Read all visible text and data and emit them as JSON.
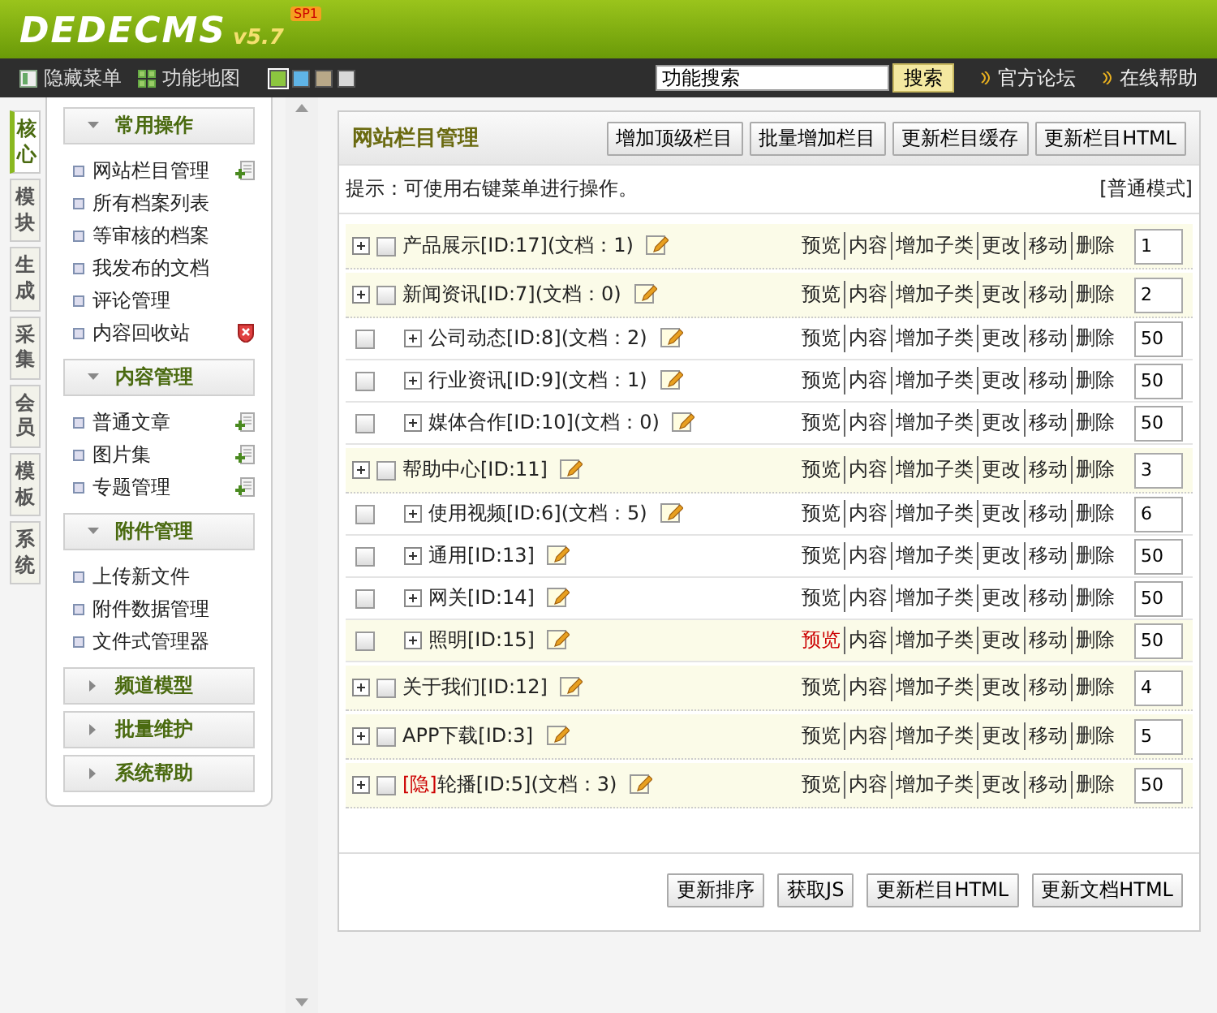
{
  "header": {
    "logo": "DEDECMS",
    "version": "v5.7",
    "edition": "SP1"
  },
  "toolbar": {
    "items": [
      {
        "label": "隐藏菜单",
        "kind": "hide"
      },
      {
        "label": "功能地图",
        "kind": "map"
      }
    ],
    "swatches": [
      {
        "color": "#8cc63f",
        "selected": true
      },
      {
        "color": "#5fb4e6",
        "selected": false
      },
      {
        "color": "#b8a888",
        "selected": false
      },
      {
        "color": "#d8d8d8",
        "selected": false
      }
    ],
    "search": {
      "value": "功能搜索",
      "button": "搜索"
    },
    "links": [
      "官方论坛",
      "在线帮助"
    ]
  },
  "side_tabs": [
    {
      "label": "核心",
      "selected": true
    },
    {
      "label": "模块",
      "selected": false
    },
    {
      "label": "生成",
      "selected": false
    },
    {
      "label": "采集",
      "selected": false
    },
    {
      "label": "会员",
      "selected": false
    },
    {
      "label": "模板",
      "selected": false
    },
    {
      "label": "系统",
      "selected": false
    }
  ],
  "menu_groups": [
    {
      "title": "常用操作",
      "expanded": true,
      "items": [
        {
          "label": "网站栏目管理",
          "kind": "add"
        },
        {
          "label": "所有档案列表",
          "kind": "plain"
        },
        {
          "label": "等审核的档案",
          "kind": "plain"
        },
        {
          "label": "我发布的文档",
          "kind": "plain"
        },
        {
          "label": "评论管理",
          "kind": "plain"
        },
        {
          "label": "内容回收站",
          "kind": "delete"
        }
      ]
    },
    {
      "title": "内容管理",
      "expanded": true,
      "items": [
        {
          "label": "普通文章",
          "kind": "add"
        },
        {
          "label": "图片集",
          "kind": "add"
        },
        {
          "label": "专题管理",
          "kind": "add"
        }
      ]
    },
    {
      "title": "附件管理",
      "expanded": true,
      "items": [
        {
          "label": "上传新文件",
          "kind": "plain"
        },
        {
          "label": "附件数据管理",
          "kind": "plain"
        },
        {
          "label": "文件式管理器",
          "kind": "plain"
        }
      ]
    },
    {
      "title": "频道模型",
      "expanded": false
    },
    {
      "title": "批量维护",
      "expanded": false
    },
    {
      "title": "系统帮助",
      "expanded": false
    }
  ],
  "panel": {
    "title": "网站栏目管理",
    "buttons": [
      "增加顶级栏目",
      "批量增加栏目",
      "更新栏目缓存",
      "更新栏目HTML"
    ],
    "hint": "提示：可使用右键菜单进行操作。",
    "mode": "[普通模式]",
    "categories": [
      {
        "label": "产品展示[ID:17](文档：1)",
        "order": "1",
        "hovered": false,
        "actions": [
          "预览",
          "内容",
          "增加子类",
          "更改",
          "移动",
          "删除"
        ]
      },
      {
        "label": "新闻资讯[ID:7](文档：0)",
        "order": "2",
        "hovered": false,
        "actions": [
          "预览",
          "内容",
          "增加子类",
          "更改",
          "移动",
          "删除"
        ],
        "children": [
          {
            "label": "公司动态[ID:8](文档：2)",
            "order": "50",
            "hovered": false,
            "actions": [
              "预览",
              "内容",
              "增加子类",
              "更改",
              "移动",
              "删除"
            ]
          },
          {
            "label": "行业资讯[ID:9](文档：1)",
            "order": "50",
            "hovered": false,
            "actions": [
              "预览",
              "内容",
              "增加子类",
              "更改",
              "移动",
              "删除"
            ]
          },
          {
            "label": "媒体合作[ID:10](文档：0)",
            "order": "50",
            "hovered": false,
            "actions": [
              "预览",
              "内容",
              "增加子类",
              "更改",
              "移动",
              "删除"
            ]
          }
        ]
      },
      {
        "label": "帮助中心[ID:11]",
        "order": "3",
        "hovered": false,
        "actions": [
          "预览",
          "内容",
          "增加子类",
          "更改",
          "移动",
          "删除"
        ],
        "children": [
          {
            "label": "使用视频[ID:6](文档：5)",
            "order": "6",
            "hovered": false,
            "actions": [
              "预览",
              "内容",
              "增加子类",
              "更改",
              "移动",
              "删除"
            ]
          },
          {
            "label": "通用[ID:13]",
            "order": "50",
            "hovered": false,
            "actions": [
              "预览",
              "内容",
              "增加子类",
              "更改",
              "移动",
              "删除"
            ]
          },
          {
            "label": "网关[ID:14]",
            "order": "50",
            "hovered": false,
            "actions": [
              "预览",
              "内容",
              "增加子类",
              "更改",
              "移动",
              "删除"
            ]
          },
          {
            "label": "照明[ID:15]",
            "order": "50",
            "hovered": true,
            "actions": [
              "预览",
              "内容",
              "增加子类",
              "更改",
              "移动",
              "删除"
            ]
          }
        ]
      },
      {
        "label": "关于我们[ID:12]",
        "order": "4",
        "hovered": false,
        "actions": [
          "预览",
          "内容",
          "增加子类",
          "更改",
          "移动",
          "删除"
        ]
      },
      {
        "label": "APP下载[ID:3]",
        "order": "5",
        "hovered": false,
        "actions": [
          "预览",
          "内容",
          "增加子类",
          "更改",
          "移动",
          "删除"
        ]
      },
      {
        "tag": "[隐]",
        "label": "轮播[ID:5](文档：3)",
        "order": "50",
        "hovered": false,
        "actions": [
          "预览",
          "内容",
          "增加子类",
          "更改",
          "移动",
          "删除"
        ]
      }
    ],
    "footer_buttons": [
      "更新排序",
      "获取JS",
      "更新栏目HTML",
      "更新文档HTML"
    ]
  }
}
